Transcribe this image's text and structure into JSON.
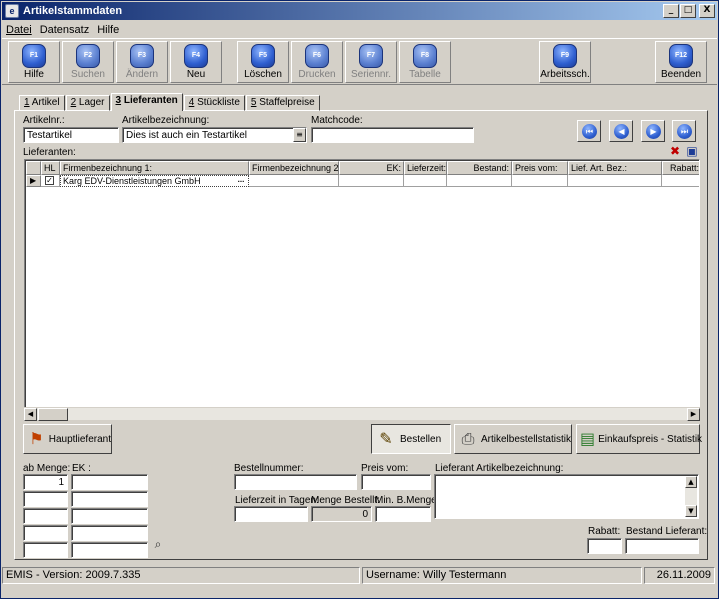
{
  "window": {
    "title": "Artikelstammdaten",
    "icon": "app-icon",
    "buttons": [
      "_",
      "□",
      "X"
    ]
  },
  "menu": [
    "Datei",
    "Datensatz",
    "Hilfe"
  ],
  "toolbar": [
    {
      "key": "F1",
      "label": "Hilfe",
      "enabled": true
    },
    {
      "key": "F2",
      "label": "Suchen",
      "enabled": false
    },
    {
      "key": "F3",
      "label": "Ändern",
      "enabled": false
    },
    {
      "key": "F4",
      "label": "Neu",
      "enabled": true
    },
    {
      "key": "F5",
      "label": "Löschen",
      "enabled": true
    },
    {
      "key": "F6",
      "label": "Drucken",
      "enabled": false
    },
    {
      "key": "F7",
      "label": "Seriennr.",
      "enabled": false
    },
    {
      "key": "F8",
      "label": "Tabelle",
      "enabled": false
    },
    {
      "key": "F9",
      "label": "Arbeitssch.",
      "enabled": true
    },
    {
      "key": "F12",
      "label": "Beenden",
      "enabled": true
    }
  ],
  "tabs": [
    {
      "num": "1",
      "label": " Artikel"
    },
    {
      "num": "2",
      "label": " Lager"
    },
    {
      "num": "3",
      "label": " Lieferanten",
      "active": true
    },
    {
      "num": "4",
      "label": " Stückliste"
    },
    {
      "num": "5",
      "label": " Staffelpreise"
    }
  ],
  "header": {
    "artikelnr_label": "Artikelnr.:",
    "artikelnr_value": "Testartikel",
    "bezeichnung_label": "Artikelbezeichnung:",
    "bezeichnung_value": "Dies ist auch ein Testartikel",
    "matchcode_label": "Matchcode:",
    "matchcode_value": ""
  },
  "nav_buttons": [
    "first-record-icon",
    "previous-record-icon",
    "next-record-icon",
    "last-record-icon"
  ],
  "lieferanten": {
    "label": "Lieferanten:",
    "columns": [
      "HL",
      "Firmenbezeichnung 1:",
      "Firmenbezeichnung 2:",
      "EK:",
      "Lieferzeit:",
      "Bestand:",
      "Preis vom:",
      "Lief. Art. Bez.:",
      "Rabatt:"
    ],
    "rows": [
      {
        "hl": "✓",
        "firma1": "Karg EDV-Dienstleistungen GmbH",
        "firma2": "",
        "ek": "",
        "lieferzeit": "",
        "bestand": "",
        "preis_vom": "",
        "lief_art_bez": "",
        "rabatt": ""
      }
    ],
    "ellipsis": "..."
  },
  "buttons": {
    "hauptlieferant": "Hauptlieferant",
    "bestellen": "Bestellen",
    "artikelbestellstatistik": "Artikelbestellstatistik",
    "einkaufspreis_statistik": "Einkaufspreis - Statistik"
  },
  "staffel": {
    "ab_menge_label": "ab Menge:",
    "ek_label": "EK :",
    "rows": [
      {
        "menge": "1",
        "ek": ""
      },
      {
        "menge": "",
        "ek": ""
      },
      {
        "menge": "",
        "ek": ""
      },
      {
        "menge": "",
        "ek": ""
      },
      {
        "menge": "",
        "ek": ""
      }
    ]
  },
  "details": {
    "bestellnummer_label": "Bestellnummer:",
    "bestellnummer_value": "",
    "preis_vom_label": "Preis vom:",
    "preis_vom_value": "",
    "lieferant_bez_label": "Lieferant Artikelbezeichnung:",
    "lieferzeit_label": "Lieferzeit in Tagen:",
    "lieferzeit_value": "",
    "menge_bestellt_label": "Menge Bestellt:",
    "menge_bestellt_value": "0",
    "min_menge_label": "Min. B.Menge:",
    "min_menge_value": "",
    "rabatt_label": "Rabatt:",
    "rabatt_value": "",
    "bestand_label": "Bestand Lieferant:",
    "bestand_value": ""
  },
  "status": {
    "version": "EMIS - Version: 2009.7.335",
    "user": "Username: Willy Testermann",
    "date": "26.11.2009"
  }
}
